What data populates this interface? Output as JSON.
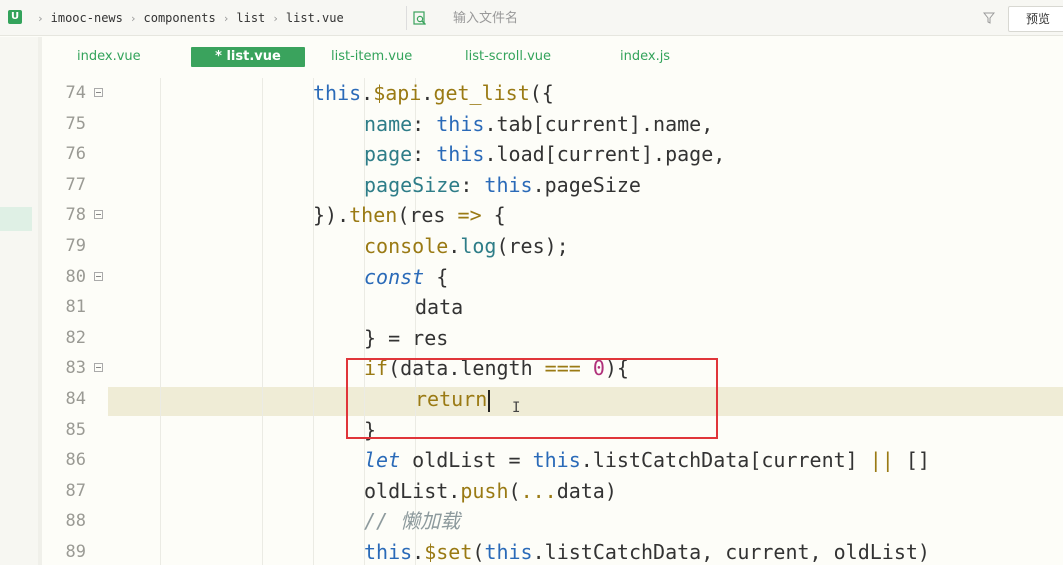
{
  "breadcrumb": [
    "imooc-news",
    "components",
    "list",
    "list.vue"
  ],
  "search": {
    "placeholder": "输入文件名"
  },
  "preview_label": "预览",
  "tabs": [
    {
      "label": "index.vue",
      "active": false
    },
    {
      "label": "* list.vue",
      "active": true
    },
    {
      "label": "list-item.vue",
      "active": false
    },
    {
      "label": "list-scroll.vue",
      "active": false
    },
    {
      "label": "index.js",
      "active": false
    }
  ],
  "colors": {
    "accent": "#3aa35d",
    "highlight_box": "#e0353a",
    "current_line": "#efecd6"
  },
  "lines": [
    {
      "num": "74",
      "fold": true,
      "indent": 0,
      "tokens": [
        [
          "kw",
          "this"
        ],
        [
          "",
          "."
        ],
        [
          "fn",
          "$api"
        ],
        [
          "",
          "."
        ],
        [
          "fn",
          "get_list"
        ],
        [
          "",
          "({"
        ]
      ]
    },
    {
      "num": "75",
      "fold": false,
      "indent": 1,
      "tokens": [
        [
          "prop",
          "name"
        ],
        [
          "",
          ": "
        ],
        [
          "kw",
          "this"
        ],
        [
          "",
          "."
        ],
        [
          "",
          "tab[current]"
        ],
        [
          "",
          "."
        ],
        [
          "",
          "name,"
        ]
      ]
    },
    {
      "num": "76",
      "fold": false,
      "indent": 1,
      "tokens": [
        [
          "prop",
          "page"
        ],
        [
          "",
          ": "
        ],
        [
          "kw",
          "this"
        ],
        [
          "",
          "."
        ],
        [
          "",
          "load[current]"
        ],
        [
          "",
          "."
        ],
        [
          "",
          "page,"
        ]
      ]
    },
    {
      "num": "77",
      "fold": false,
      "indent": 1,
      "tokens": [
        [
          "prop",
          "pageSize"
        ],
        [
          "",
          ": "
        ],
        [
          "kw",
          "this"
        ],
        [
          "",
          "."
        ],
        [
          "",
          "pageSize"
        ]
      ]
    },
    {
      "num": "78",
      "fold": true,
      "indent": 0,
      "tokens": [
        [
          "",
          "})"
        ],
        [
          "",
          "."
        ],
        [
          "fn",
          "then"
        ],
        [
          "",
          "(res "
        ],
        [
          "op",
          "=>"
        ],
        [
          "",
          " {"
        ]
      ]
    },
    {
      "num": "79",
      "fold": false,
      "indent": 1,
      "tokens": [
        [
          "fn",
          "console"
        ],
        [
          "",
          "."
        ],
        [
          "prop",
          "log"
        ],
        [
          "",
          "(res);"
        ]
      ]
    },
    {
      "num": "80",
      "fold": true,
      "indent": 1,
      "tokens": [
        [
          "kwi",
          "const"
        ],
        [
          "",
          " {"
        ]
      ]
    },
    {
      "num": "81",
      "fold": false,
      "indent": 2,
      "tokens": [
        [
          "",
          "data"
        ]
      ]
    },
    {
      "num": "82",
      "fold": false,
      "indent": 1,
      "tokens": [
        [
          "",
          "} = res"
        ]
      ]
    },
    {
      "num": "83",
      "fold": true,
      "indent": 1,
      "tokens": [
        [
          "fn",
          "if"
        ],
        [
          "",
          "(data"
        ],
        [
          "",
          "."
        ],
        [
          "",
          "length "
        ],
        [
          "op",
          "==="
        ],
        [
          "",
          " "
        ],
        [
          "num",
          "0"
        ],
        [
          "",
          "){"
        ]
      ]
    },
    {
      "num": "84",
      "fold": false,
      "indent": 2,
      "tokens": [
        [
          "fn",
          "return"
        ]
      ],
      "caret": true
    },
    {
      "num": "85",
      "fold": false,
      "indent": 1,
      "tokens": [
        [
          "",
          "}"
        ]
      ]
    },
    {
      "num": "86",
      "fold": false,
      "indent": 1,
      "tokens": [
        [
          "kwi",
          "let"
        ],
        [
          "",
          " oldList = "
        ],
        [
          "kw",
          "this"
        ],
        [
          "",
          "."
        ],
        [
          "",
          "listCatchData[current] "
        ],
        [
          "op",
          "||"
        ],
        [
          "",
          " []"
        ]
      ]
    },
    {
      "num": "87",
      "fold": false,
      "indent": 1,
      "tokens": [
        [
          "",
          "oldList"
        ],
        [
          "",
          "."
        ],
        [
          "fn",
          "push"
        ],
        [
          "",
          "("
        ],
        [
          "op",
          "..."
        ],
        [
          "",
          "data)"
        ]
      ]
    },
    {
      "num": "88",
      "fold": false,
      "indent": 1,
      "tokens": [
        [
          "cm",
          "// 懒加载"
        ]
      ]
    },
    {
      "num": "89",
      "fold": false,
      "indent": 1,
      "tokens": [
        [
          "kw",
          "this"
        ],
        [
          "",
          "."
        ],
        [
          "fn",
          "$set"
        ],
        [
          "",
          "("
        ],
        [
          "kw",
          "this"
        ],
        [
          "",
          "."
        ],
        [
          "",
          "listCatchData, current, oldList)"
        ]
      ]
    }
  ]
}
